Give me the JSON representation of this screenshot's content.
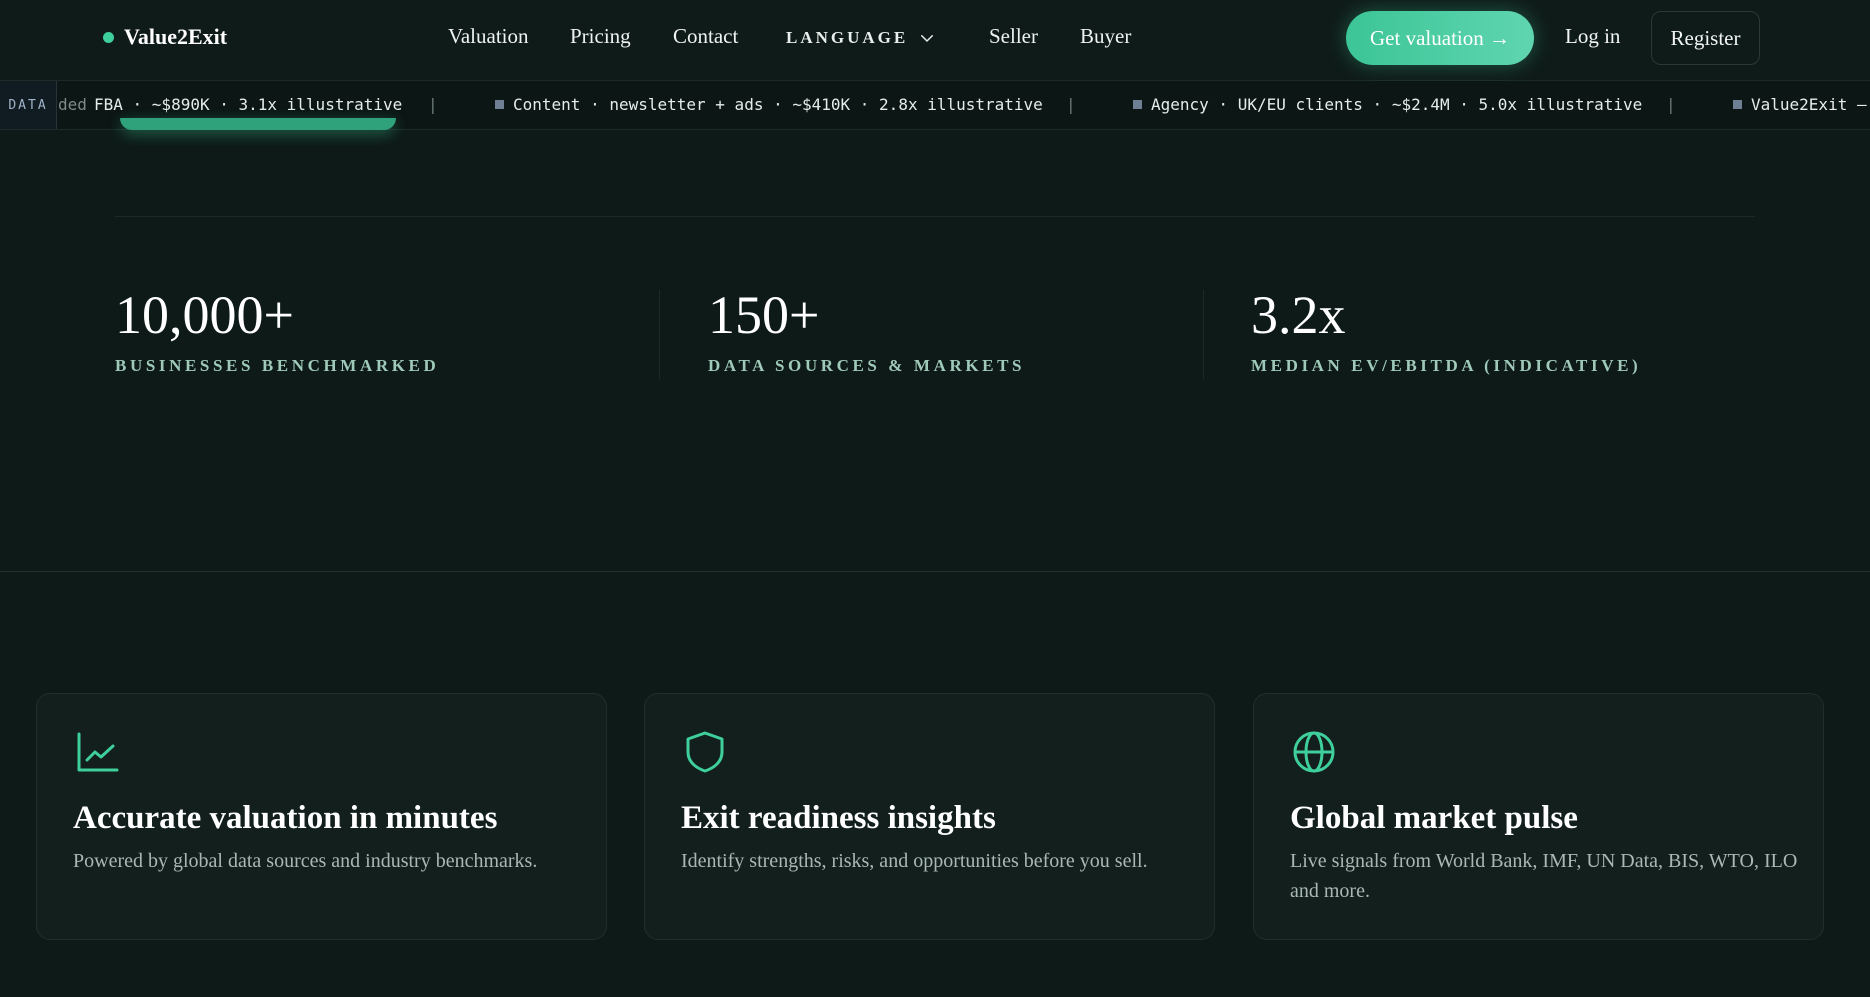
{
  "brand": {
    "name": "Value2Exit"
  },
  "nav": {
    "links": [
      "Valuation",
      "Pricing",
      "Contact"
    ],
    "language": "LANGUAGE",
    "links2": [
      "Seller",
      "Buyer"
    ]
  },
  "header": {
    "cta": "Get valuation →",
    "login": "Log in",
    "register": "Register"
  },
  "ticker": {
    "tag": "DATA",
    "faded": "ded",
    "items": [
      "FBA · ~$890K · 3.1x illustrative",
      "Content · newsletter + ads · ~$410K · 2.8x illustrative",
      "Agency · UK/EU clients · ~$2.4M · 5.0x illustrative",
      "Value2Exit —"
    ],
    "separator": "|"
  },
  "stats": [
    {
      "value": "10,000+",
      "label": "BUSINESSES BENCHMARKED"
    },
    {
      "value": "150+",
      "label": "DATA SOURCES & MARKETS"
    },
    {
      "value": "3.2x",
      "label": "MEDIAN EV/EBITDA (INDICATIVE)"
    }
  ],
  "features": [
    {
      "icon": "line-chart-icon",
      "title": "Accurate valuation in minutes",
      "desc": "Powered by global data sources and industry benchmarks."
    },
    {
      "icon": "shield-icon",
      "title": "Exit readiness insights",
      "desc": "Identify strengths, risks, and opportunities before you sell."
    },
    {
      "icon": "globe-icon",
      "title": "Global market pulse",
      "desc": "Live signals from World Bank, IMF, UN Data, BIS, WTO, ILO and more."
    }
  ],
  "colors": {
    "accent": "#3ecf9c",
    "background": "#0e1a18",
    "card": "#121f1d"
  }
}
